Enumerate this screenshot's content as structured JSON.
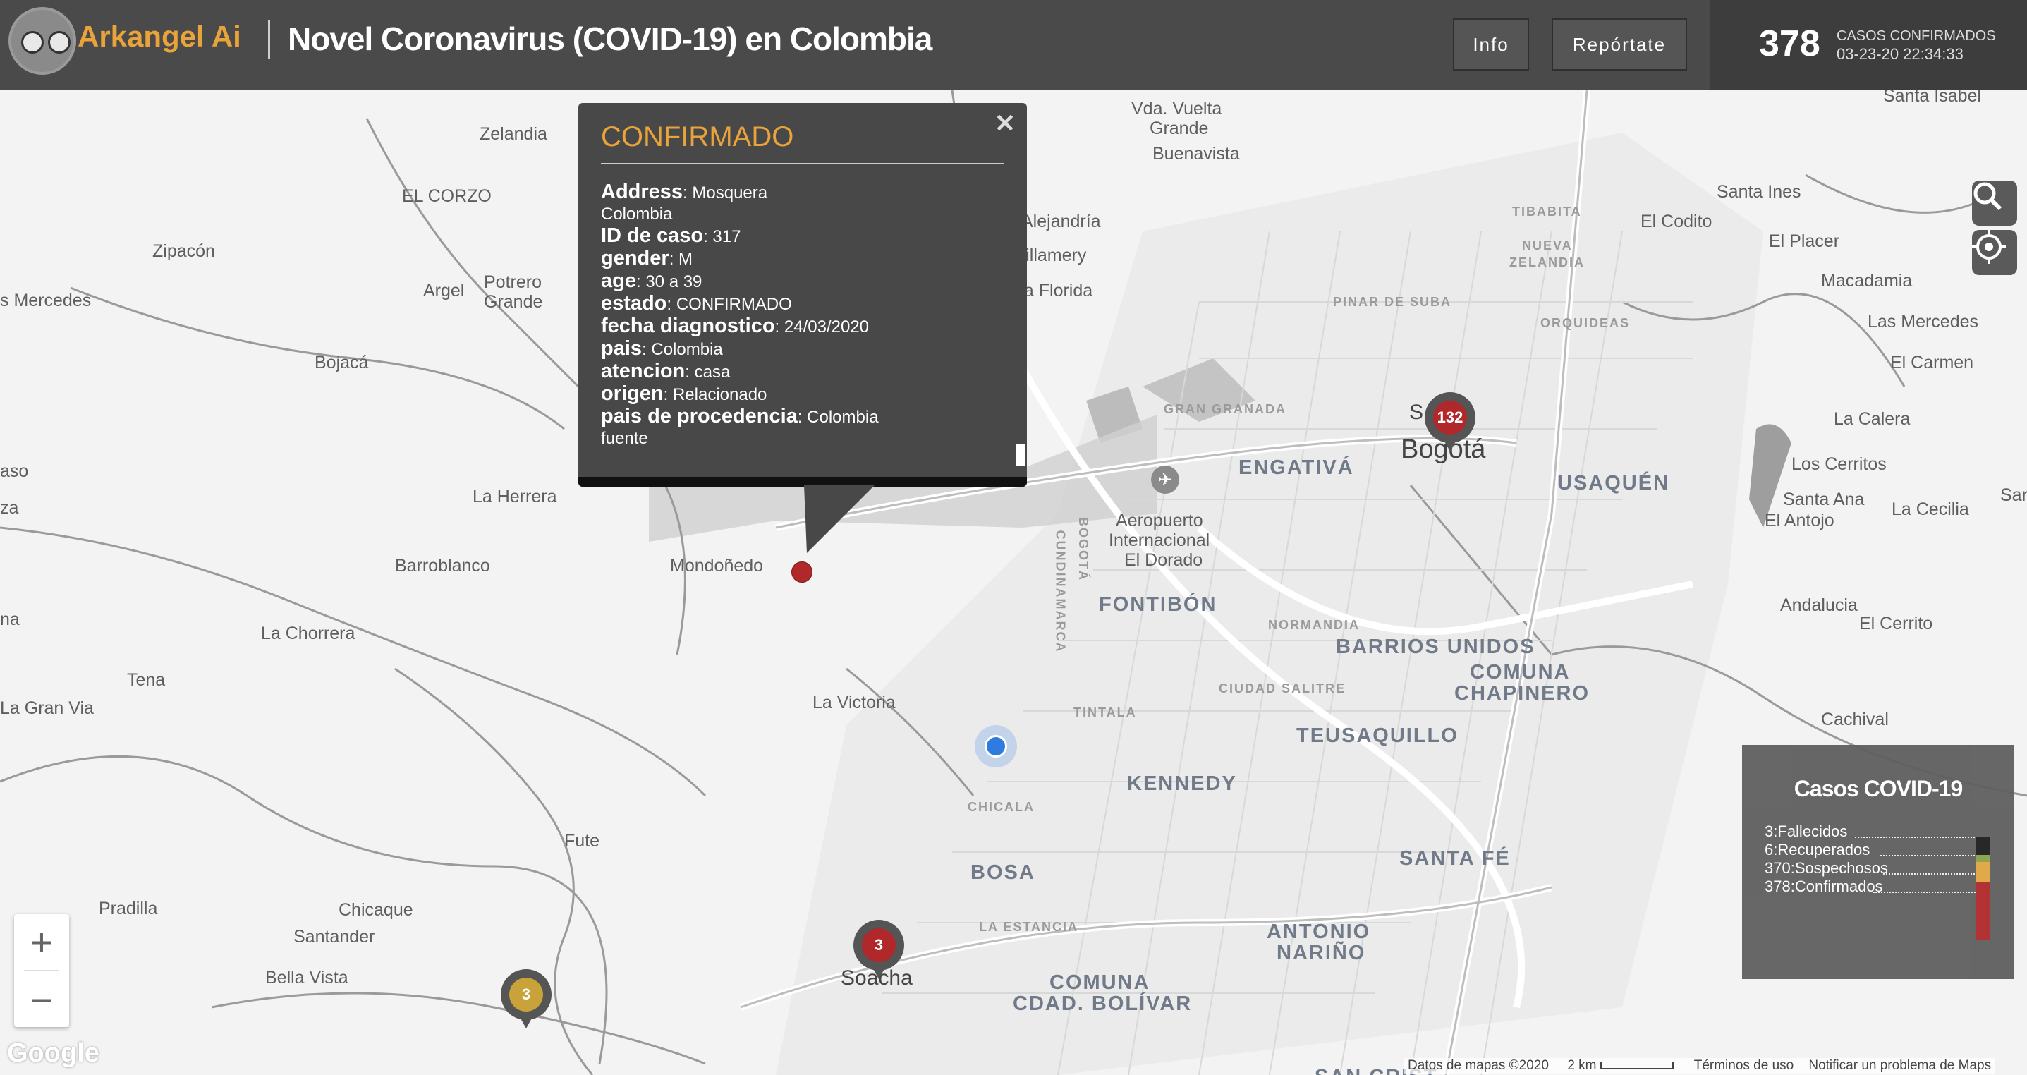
{
  "header": {
    "logo_text": "Arkangel Ai",
    "title": "Novel Coronavirus (COVID-19) en Colombia",
    "info_button": "Info",
    "report_button": "Repórtate",
    "confirmed_count": "378",
    "confirmed_label": "CASOS CONFIRMADOS",
    "timestamp": "03-23-20 22:34:33"
  },
  "popup": {
    "title": "CONFIRMADO",
    "close_icon": "close-icon",
    "fields": [
      {
        "label": "Address",
        "value": "Mosquera"
      },
      {
        "label": "",
        "value": "Colombia"
      },
      {
        "label": "ID de caso",
        "value": "317"
      },
      {
        "label": "gender",
        "value": "M"
      },
      {
        "label": "age",
        "value": "30 a 39"
      },
      {
        "label": "estado",
        "value": "CONFIRMADO"
      },
      {
        "label": "fecha diagnostico",
        "value": "24/03/2020"
      },
      {
        "label": "pais",
        "value": "Colombia"
      },
      {
        "label": "atencion",
        "value": "casa"
      },
      {
        "label": "origen",
        "value": "Relacionado"
      },
      {
        "label": "pais de procedencia",
        "value": "Colombia"
      },
      {
        "label": "",
        "value": "fuente"
      }
    ]
  },
  "map": {
    "places": [
      "Zelandia",
      "EL CORZO",
      "Zipacón",
      "Argel",
      "Potrero",
      "Grande",
      "s Mercedes",
      "Bojacá",
      "La Herrera",
      "Barroblanco",
      "Mondoñedo",
      "La Chorrera",
      "Tena",
      "La Gran Via",
      "La Victoria",
      "Fute",
      "Pradilla",
      "Chicaque",
      "Santander",
      "Bella Vista",
      "Alejandría",
      "Villamery",
      "La Florida",
      "Vda. Vuelta",
      "Grande",
      "Buenavista",
      "Aeropuerto",
      "Internacional",
      "El Dorado",
      "Santa Ines",
      "El Codito",
      "El Placer",
      "Macadamia",
      "Las Mercedes",
      "El Carmen",
      "La Calera",
      "Los Cerritos",
      "Santa Ana",
      "El Antojo",
      "La Cecilia",
      "Andalucia",
      "El Cerrito",
      "Cachival",
      "Santa Isabel",
      "aso",
      "za",
      "na",
      "Sar"
    ],
    "districts": [
      "ENGATIVÁ",
      "USAQUÉN",
      "FONTIBÓN",
      "BARRIOS UNIDOS",
      "COMUNA",
      "CHAPINERO",
      "TEUSAQUILLO",
      "KENNEDY",
      "SANTA FÉ",
      "BOSA",
      "ANTONIO",
      "NARIÑO",
      "COMUNA",
      "CDAD. BOLÍVAR",
      "SAN CRIST"
    ],
    "small_labels": [
      "PINAR DE SUBA",
      "TIBABITA",
      "NUEVA",
      "ZELANDIA",
      "ORQUIDEAS",
      "GRAN GRANADA",
      "NORMANDIA",
      "CIUDAD SALITRE",
      "TINTALA",
      "CHICALA",
      "LA ESTANCIA",
      "CUNDINAMARCA",
      "BOGOTÁ"
    ],
    "cities": [
      "Bogotá",
      "Soacha",
      "S"
    ],
    "clusters": [
      {
        "label": "132",
        "color": "#b0282a"
      },
      {
        "label": "3",
        "color": "#b0282a"
      },
      {
        "label": "3",
        "color": "#c9a23a"
      }
    ],
    "controls": {
      "search_icon": "search-icon",
      "locate_icon": "crosshair-icon",
      "zoom_in": "+",
      "zoom_out": "−"
    }
  },
  "legend": {
    "title": "Casos COVID-19",
    "items": [
      {
        "count": "3",
        "label": "Fallecidos",
        "color": "#1e1e1e"
      },
      {
        "count": "6",
        "label": "Recuperados",
        "color": "#8aa04a"
      },
      {
        "count": "370",
        "label": "Sospechosos",
        "color": "#e0a640"
      },
      {
        "count": "378",
        "label": "Confirmados",
        "color": "#b0282a"
      }
    ]
  },
  "footer": {
    "google": "Google",
    "map_data": "Datos de mapas ©2020",
    "scale": "2 km",
    "terms": "Términos de uso",
    "report": "Notificar un problema de Maps"
  },
  "colors": {
    "accent": "#e8a33a",
    "confirmed": "#b0282a",
    "header_bg": "#4a4a4a"
  }
}
